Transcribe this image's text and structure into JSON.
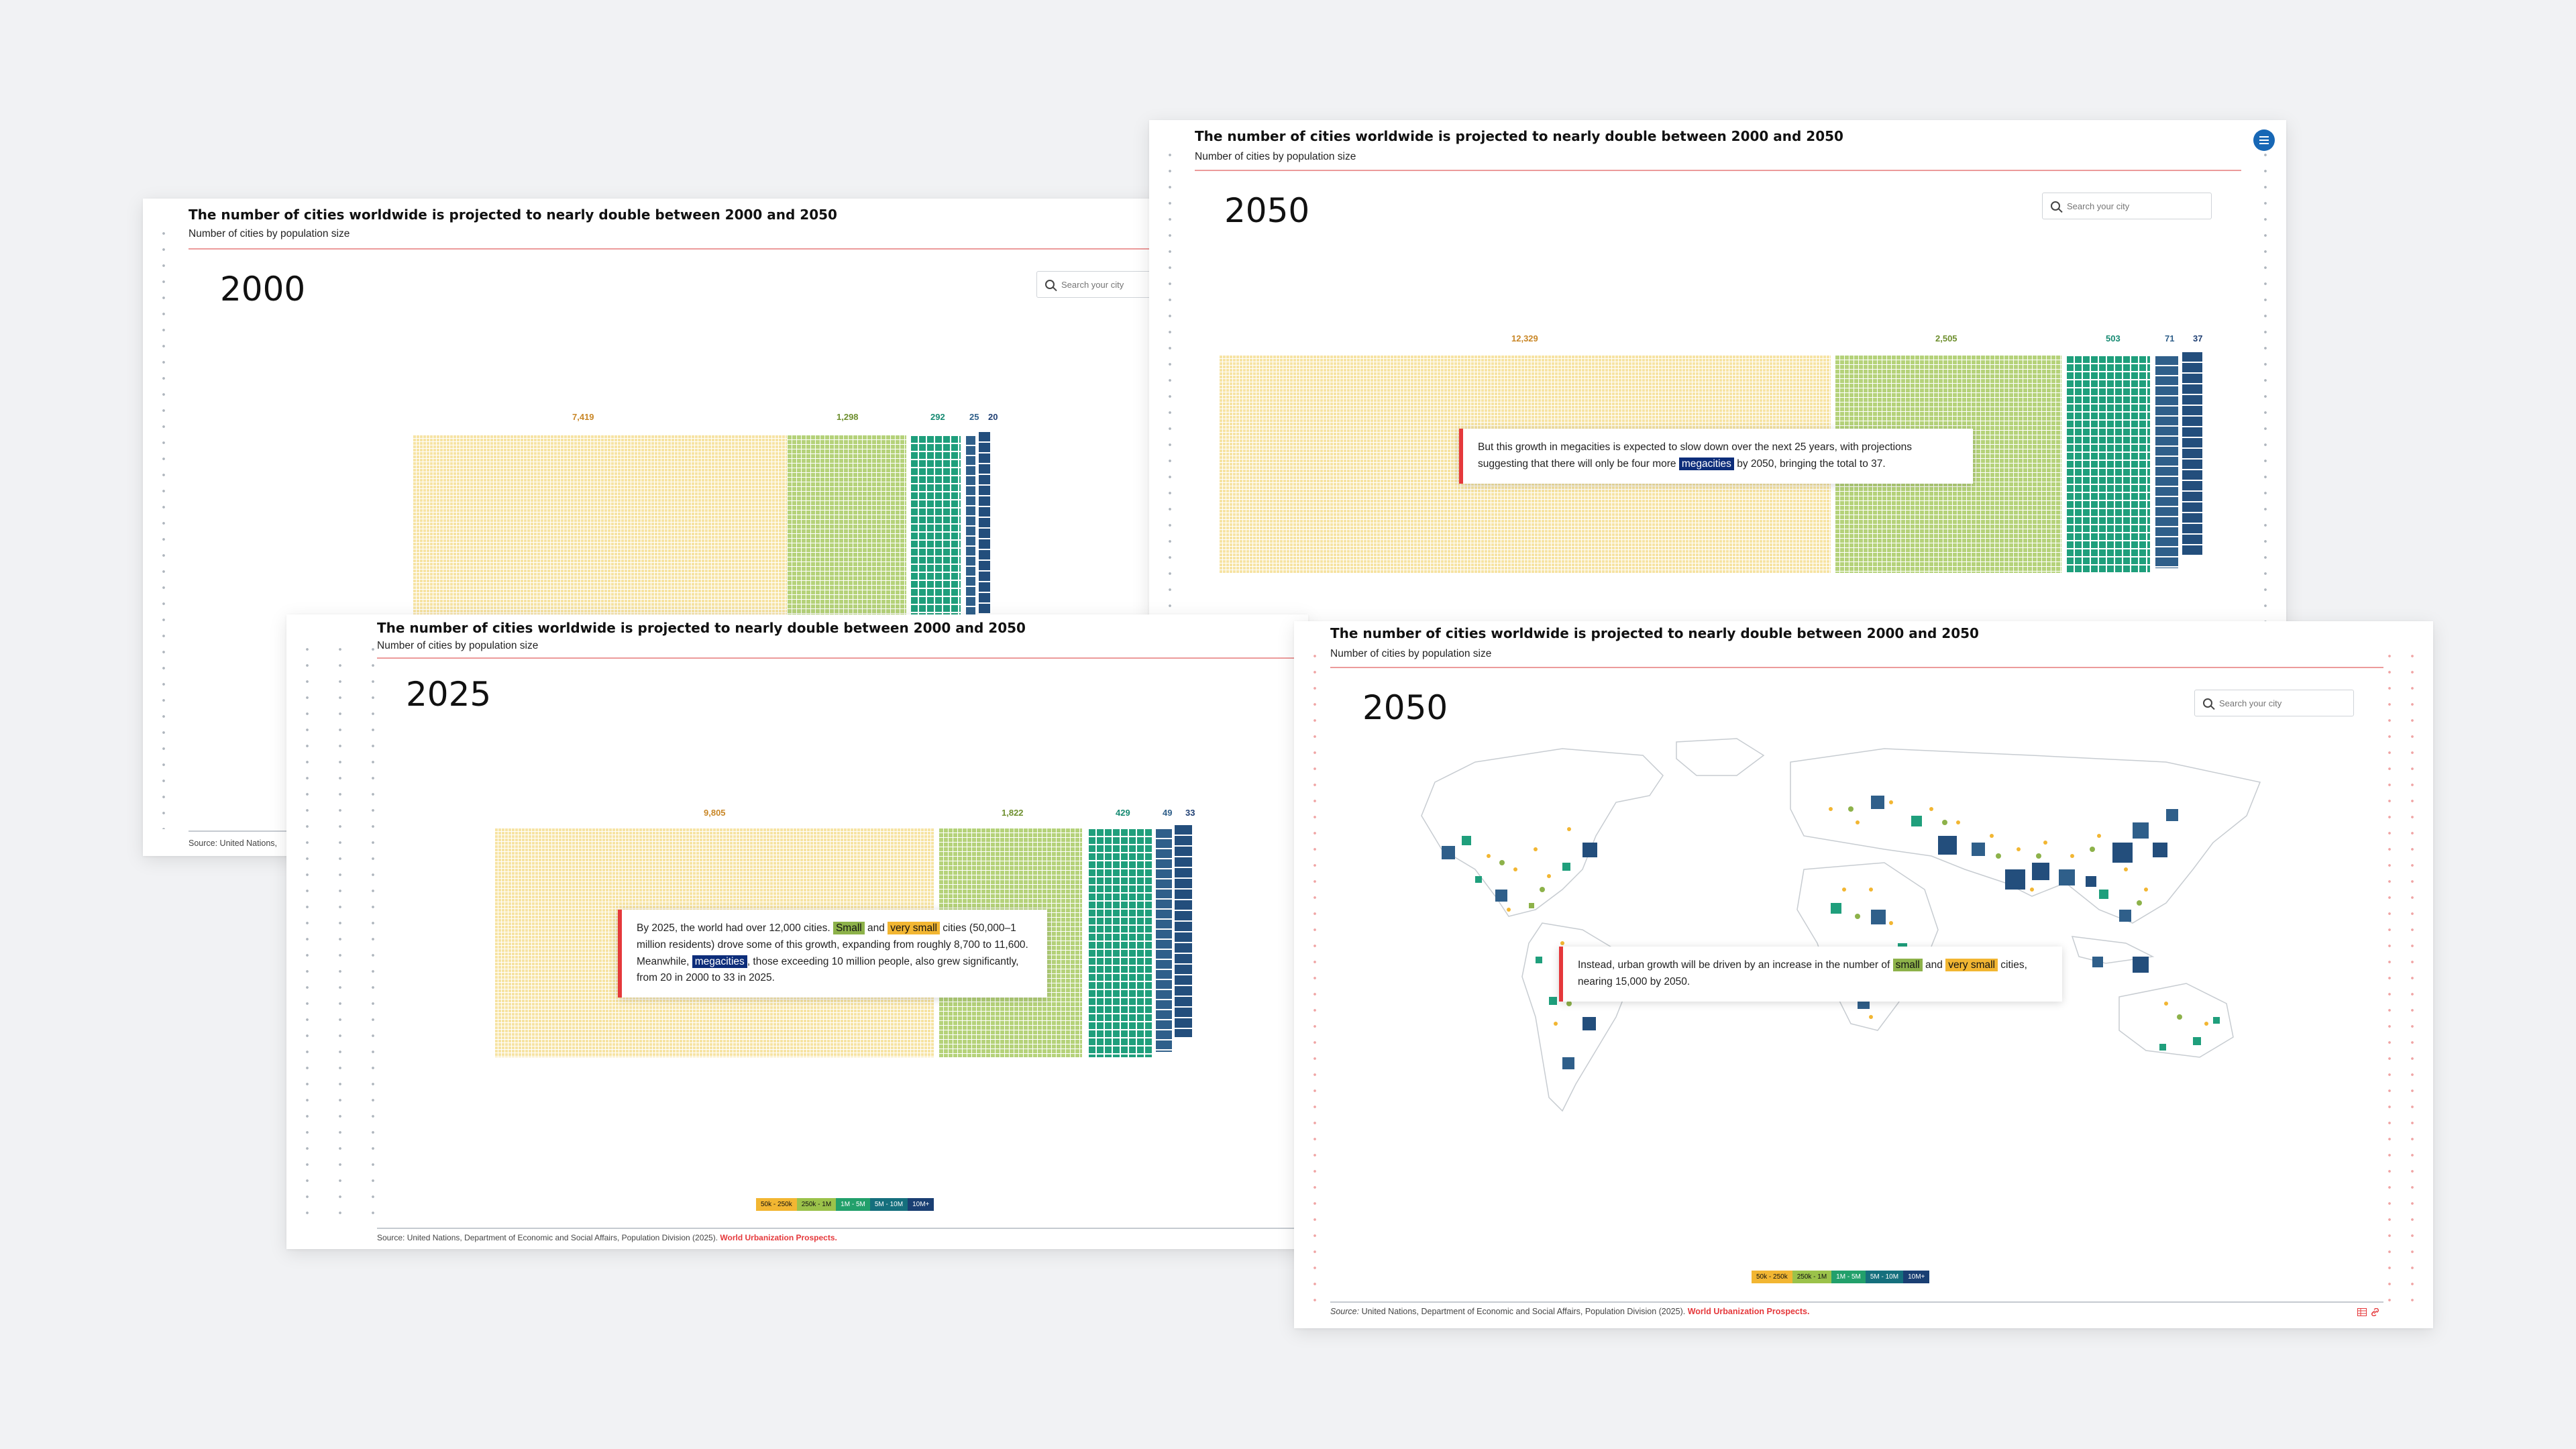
{
  "chart": {
    "title": "The number of cities worldwide is projected to nearly double between 2000 and 2050",
    "subtitle": "Number of cities by population size"
  },
  "search": {
    "placeholder": "Search your city"
  },
  "legend": [
    "50k - 250k",
    "250k - 1M",
    "1M - 5M",
    "5M - 10M",
    "10M+"
  ],
  "source": {
    "prefix": "Source:",
    "text": " United Nations, Department of Economic and Social Affairs, Population Division (2025). ",
    "link": "World Urbanization Prospects.",
    "truncated": "Source: United Nations,"
  },
  "cards": {
    "y2000": {
      "year": "2000"
    },
    "y2025": {
      "year": "2025",
      "annotation": {
        "t1": "By 2025, the world had over 12,000 cities. ",
        "small": "Small",
        "t2": " and ",
        "vsmall": "very small",
        "t3": " cities (50,000–1 million residents) drove some of this growth, expanding from roughly 8,700 to 11,600. Meanwhile, ",
        "mega": "megacities",
        "t4": ", those exceeding 10 million people, also grew significantly, from 20 in 2000 to 33 in 2025."
      }
    },
    "y2050a": {
      "year": "2050",
      "annotation": {
        "t1": "But this growth in megacities is expected to slow down over the next 25 years, with projections suggesting that there will only be four more ",
        "mega": "megacities",
        "t2": " by 2050, bringing the total to 37."
      }
    },
    "y2050b": {
      "year": "2050",
      "annotation": {
        "t1": "Instead, urban growth will be driven by an increase in the number of ",
        "small": "small",
        "t2": " and ",
        "vsmall": "very small",
        "t3": " cities, nearing 15,000 by 2050."
      }
    }
  },
  "chart_data": [
    {
      "type": "bar",
      "year": "2000",
      "categories": [
        "50k - 250k",
        "250k - 1M",
        "1M - 5M",
        "5M - 10M",
        "10M+"
      ],
      "values": [
        7419,
        1298,
        292,
        25,
        20
      ]
    },
    {
      "type": "bar",
      "year": "2025",
      "categories": [
        "50k - 250k",
        "250k - 1M",
        "1M - 5M",
        "5M - 10M",
        "10M+"
      ],
      "values": [
        9805,
        1822,
        429,
        49,
        33
      ]
    },
    {
      "type": "bar",
      "year": "2050",
      "categories": [
        "50k - 250k",
        "250k - 1M",
        "1M - 5M",
        "5M - 10M",
        "10M+"
      ],
      "values": [
        12329,
        2505,
        503,
        71,
        37
      ]
    }
  ],
  "value_labels": {
    "y2000": [
      "7,419",
      "1,298",
      "292",
      "25",
      "20"
    ],
    "y2025": [
      "9,805",
      "1,822",
      "429",
      "49",
      "33"
    ],
    "y2050": [
      "12,329",
      "2,505",
      "503",
      "71",
      "37"
    ]
  },
  "colors": {
    "accent": "#e5383b",
    "megacity": "#0d2d7a",
    "small": "#8db24a",
    "very_small": "#f2b632"
  }
}
